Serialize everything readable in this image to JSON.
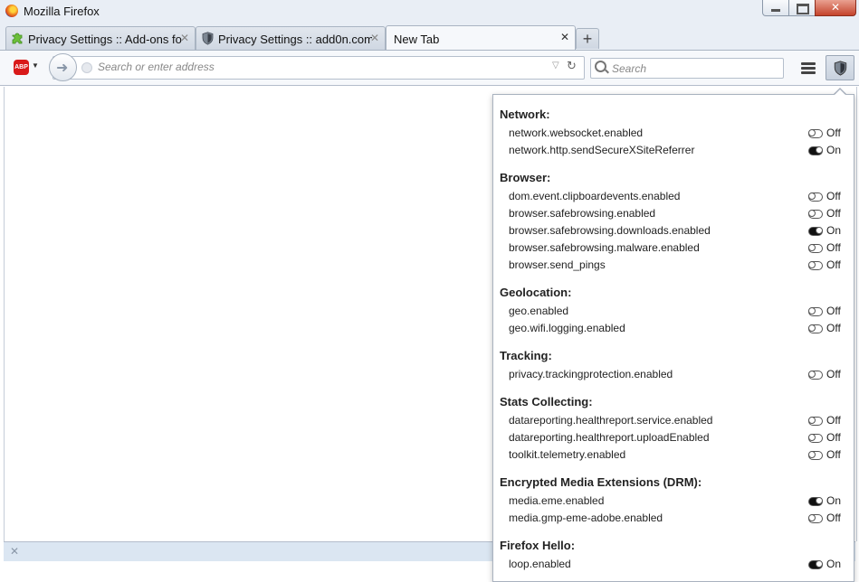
{
  "window": {
    "title": "Mozilla Firefox"
  },
  "tabs": [
    {
      "label": "Privacy Settings :: Add-ons fo...",
      "icon": "puzzle-piece-icon"
    },
    {
      "label": "Privacy Settings :: add0n.com",
      "icon": "shield-icon"
    },
    {
      "label": "New Tab",
      "active": true
    }
  ],
  "toolbar": {
    "url_placeholder": "Search or enter address",
    "search_placeholder": "Search",
    "abp_label": "ABP"
  },
  "panel": {
    "sections": [
      {
        "title": "Network:",
        "prefs": [
          {
            "name": "network.websocket.enabled",
            "state": "Off"
          },
          {
            "name": "network.http.sendSecureXSiteReferrer",
            "state": "On"
          }
        ]
      },
      {
        "title": "Browser:",
        "prefs": [
          {
            "name": "dom.event.clipboardevents.enabled",
            "state": "Off"
          },
          {
            "name": "browser.safebrowsing.enabled",
            "state": "Off"
          },
          {
            "name": "browser.safebrowsing.downloads.enabled",
            "state": "On"
          },
          {
            "name": "browser.safebrowsing.malware.enabled",
            "state": "Off"
          },
          {
            "name": "browser.send_pings",
            "state": "Off"
          }
        ]
      },
      {
        "title": "Geolocation:",
        "prefs": [
          {
            "name": "geo.enabled",
            "state": "Off"
          },
          {
            "name": "geo.wifi.logging.enabled",
            "state": "Off"
          }
        ]
      },
      {
        "title": "Tracking:",
        "prefs": [
          {
            "name": "privacy.trackingprotection.enabled",
            "state": "Off"
          }
        ]
      },
      {
        "title": "Stats Collecting:",
        "prefs": [
          {
            "name": "datareporting.healthreport.service.enabled",
            "state": "Off"
          },
          {
            "name": "datareporting.healthreport.uploadEnabled",
            "state": "Off"
          },
          {
            "name": "toolkit.telemetry.enabled",
            "state": "Off"
          }
        ]
      },
      {
        "title": "Encrypted Media Extensions (DRM):",
        "prefs": [
          {
            "name": "media.eme.enabled",
            "state": "On"
          },
          {
            "name": "media.gmp-eme-adobe.enabled",
            "state": "Off"
          }
        ]
      },
      {
        "title": "Firefox Hello:",
        "prefs": [
          {
            "name": "loop.enabled",
            "state": "On"
          }
        ]
      }
    ]
  }
}
